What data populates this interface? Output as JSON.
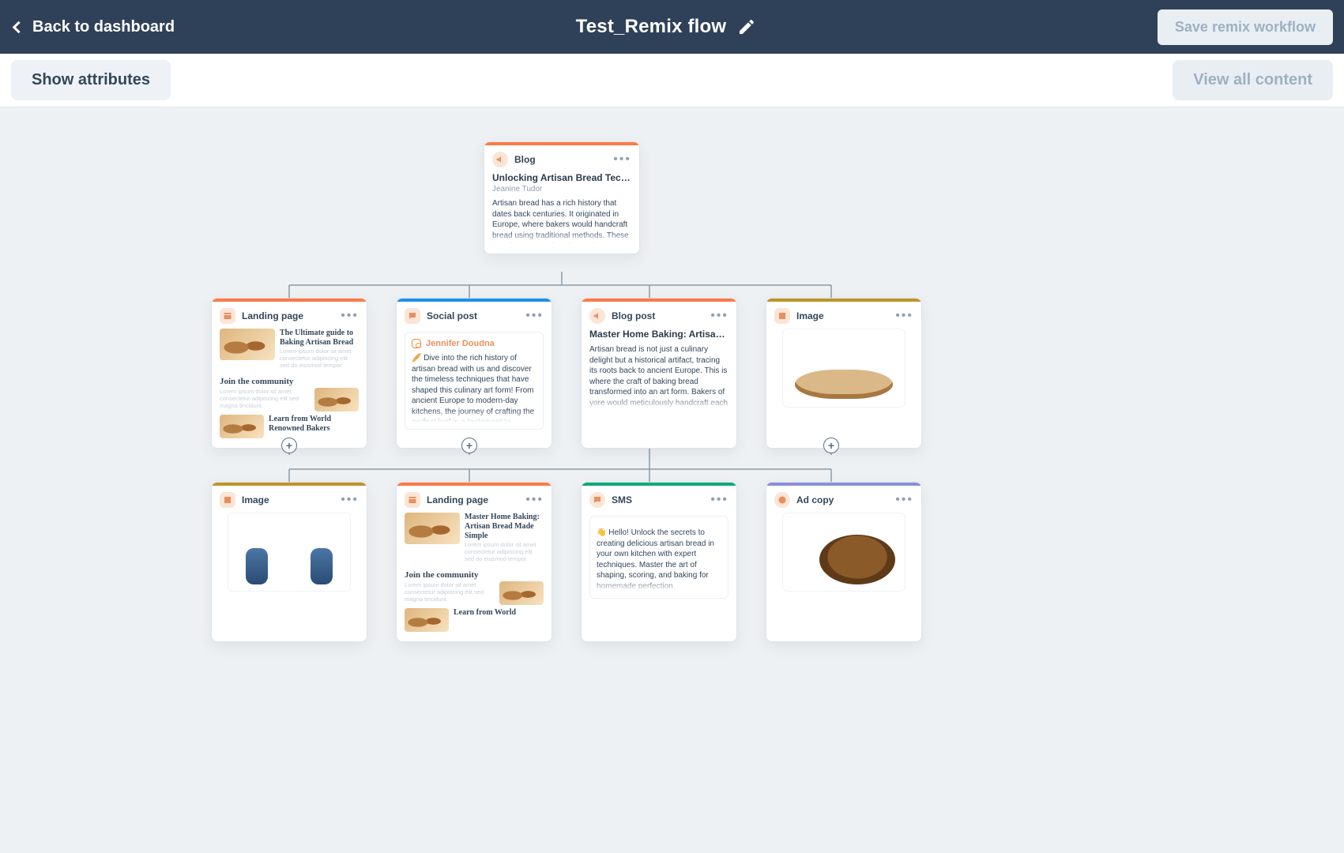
{
  "header": {
    "back_label": "Back to dashboard",
    "title": "Test_Remix flow",
    "save_label": "Save remix workflow"
  },
  "subheader": {
    "show_attrs": "Show attributes",
    "view_all": "View all content"
  },
  "accents": {
    "orange": "#ff7a45",
    "blue": "#1f90ea",
    "teal": "#0da977",
    "ochre": "#c0932a",
    "lilac": "#8a8fd6"
  },
  "root": {
    "type": "Blog",
    "title": "Unlocking Artisan Bread Technique…",
    "author": "Jeanine Tudor",
    "excerpt": "Artisan bread has a rich history that dates back centuries. It originated in Europe, where bakers would handcraft bread using traditional methods. These breads were made with simple ingredients and had a distinctive taste and texture. Over time, artisan bread became popular around the world."
  },
  "row1": [
    {
      "type": "Landing page",
      "accent": "orange",
      "variant": "landing",
      "lp": {
        "h1": "The Ultimate guide to Baking Artisan Bread",
        "h2": "Join the community",
        "h3": "Learn from World Renowned Bakers"
      }
    },
    {
      "type": "Social post",
      "accent": "blue",
      "variant": "social",
      "social": {
        "name": "Jennifer Doudna",
        "text": "🥖 Dive into the rich history of artisan bread with us and discover the timeless techniques that have shaped this culinary art form! From ancient Europe to modern-day kitchens, the journey of crafting the perfect loaf is a testament to human creativity and tradition. 🍞🔥 #ArtisanBread #BakingHistory #CulinaryTraditions"
      }
    },
    {
      "type": "Blog post",
      "accent": "orange",
      "variant": "blog",
      "blog": {
        "title": "Master Home Baking: Artisan Ba…",
        "excerpt": "Artisan bread is not just a culinary delight but a historical artifact, tracing its roots back to ancient Europe. This is where the craft of baking bread transformed into an art form. Bakers of yore would meticulously handcraft each loaf, adhering to time-honored techniques that valued simplicity and quality. With only a handful of ingredients, these"
      }
    },
    {
      "type": "Image",
      "accent": "ochre",
      "variant": "image",
      "image": "bread-kitchen"
    }
  ],
  "row2": [
    {
      "type": "Image",
      "accent": "ochre",
      "variant": "image",
      "image": "people-cafe"
    },
    {
      "type": "Landing page",
      "accent": "orange",
      "variant": "landing",
      "lp": {
        "h1": "Master Home Baking: Artisan Bread Made Simple",
        "h2": "Join the community",
        "h3": "Learn from World"
      }
    },
    {
      "type": "SMS",
      "accent": "teal",
      "variant": "sms",
      "sms": {
        "text": "👋 Hello! Unlock the secrets to creating delicious artisan bread in your own kitchen with expert techniques. Master the art of shaping, scoring, and baking for homemade perfection."
      }
    },
    {
      "type": "Ad copy",
      "accent": "lilac",
      "variant": "image",
      "image": "bread-boule"
    }
  ]
}
